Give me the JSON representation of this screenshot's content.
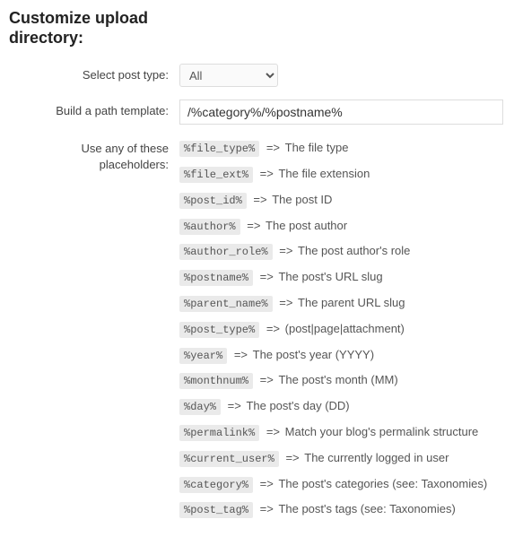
{
  "heading": "Customize upload directory:",
  "labels": {
    "select_post_type": "Select post type:",
    "build_path": "Build a path template:",
    "placeholders": "Use any of these placeholders:"
  },
  "select": {
    "value": "All",
    "options": [
      "All"
    ]
  },
  "path_template": {
    "value": "/%category%/%postname%"
  },
  "placeholders": [
    {
      "token": "%file_type%",
      "desc": "The file type"
    },
    {
      "token": "%file_ext%",
      "desc": "The file extension"
    },
    {
      "token": "%post_id%",
      "desc": "The post ID"
    },
    {
      "token": "%author%",
      "desc": "The post author"
    },
    {
      "token": "%author_role%",
      "desc": "The post author's role"
    },
    {
      "token": "%postname%",
      "desc": "The post's URL slug"
    },
    {
      "token": "%parent_name%",
      "desc": "The parent URL slug"
    },
    {
      "token": "%post_type%",
      "desc": "(post|page|attachment)"
    },
    {
      "token": "%year%",
      "desc": "The post's year (YYYY)"
    },
    {
      "token": "%monthnum%",
      "desc": "The post's month (MM)"
    },
    {
      "token": "%day%",
      "desc": "The post's day (DD)"
    },
    {
      "token": "%permalink%",
      "desc": "Match your blog's permalink structure"
    },
    {
      "token": "%current_user%",
      "desc": "The currently logged in user"
    },
    {
      "token": "%category%",
      "desc": "The post's categories (see: Taxonomies)"
    },
    {
      "token": "%post_tag%",
      "desc": "The post's tags (see: Taxonomies)"
    }
  ],
  "arrow": "=>"
}
